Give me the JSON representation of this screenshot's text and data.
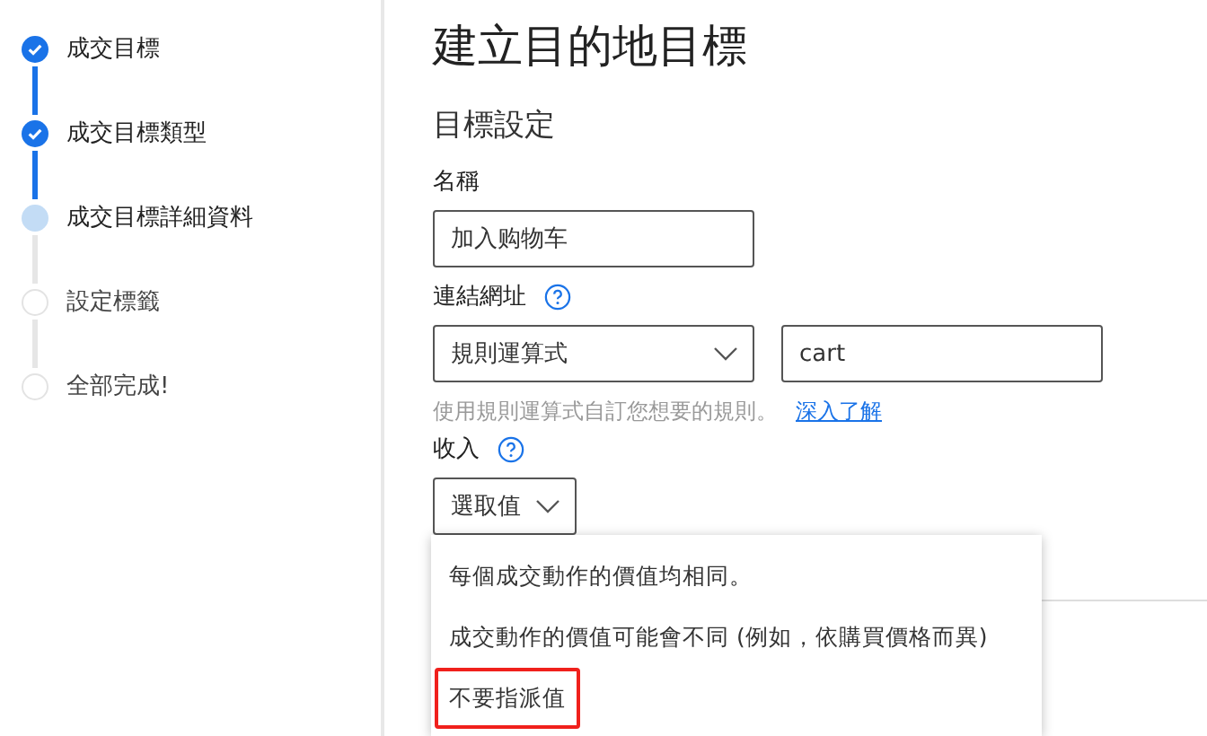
{
  "steps": [
    {
      "label": "成交目標",
      "completed": true,
      "selected": false
    },
    {
      "label": "成交目標類型",
      "completed": true,
      "selected": false
    },
    {
      "label": "成交目標詳細資料",
      "completed": false,
      "selected": true
    },
    {
      "label": "設定標籤",
      "completed": false,
      "selected": false
    },
    {
      "label": "全部完成!",
      "completed": false,
      "selected": false
    }
  ],
  "title": "建立目的地目標",
  "section": "目標設定",
  "name_field": {
    "label": "名稱",
    "value": "加入购物车"
  },
  "url_field": {
    "label": "連結網址",
    "rule": "規則運算式",
    "value": "cart",
    "hint": "使用規則運算式自訂您想要的規則。",
    "link": "深入了解"
  },
  "revenue_field": {
    "label": "收入",
    "value": "選取值",
    "expanded": true,
    "options": [
      {
        "label": "每個成交動作的價值均相同。",
        "highlighted": false
      },
      {
        "label": "成交動作的價值可能會不同 (例如，依購買價格而異)",
        "highlighted": false
      },
      {
        "label": "不要指派值",
        "highlighted": true
      }
    ]
  }
}
